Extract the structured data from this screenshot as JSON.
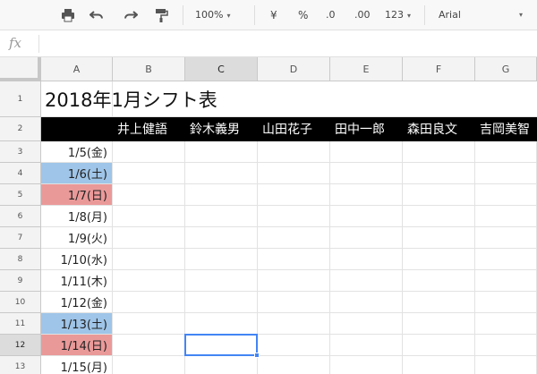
{
  "toolbar": {
    "zoom": "100%",
    "currency_symbol": "¥",
    "percent_symbol": "%",
    "decrease_decimal": ".0",
    "increase_decimal": ".00",
    "more_formats": "123",
    "font_name": "Arial",
    "caret": "▾"
  },
  "formula_bar": {
    "fx_label": "fx",
    "value": ""
  },
  "columns": [
    "A",
    "B",
    "C",
    "D",
    "E",
    "F",
    "G"
  ],
  "active_column": "C",
  "rows": [
    "1",
    "2",
    "3",
    "4",
    "5",
    "6",
    "7",
    "8",
    "9",
    "10",
    "11",
    "12",
    "13"
  ],
  "active_row": "12",
  "sheet": {
    "title": "2018年1月シフト表",
    "names": [
      "井上健語",
      "鈴木義男",
      "山田花子",
      "田中一郎",
      "森田良文",
      "吉岡美智"
    ],
    "dates": [
      {
        "label": "1/5(金)",
        "day_type": "weekday"
      },
      {
        "label": "1/6(土)",
        "day_type": "saturday"
      },
      {
        "label": "1/7(日)",
        "day_type": "sunday"
      },
      {
        "label": "1/8(月)",
        "day_type": "weekday"
      },
      {
        "label": "1/9(火)",
        "day_type": "weekday"
      },
      {
        "label": "1/10(水)",
        "day_type": "weekday"
      },
      {
        "label": "1/11(木)",
        "day_type": "weekday"
      },
      {
        "label": "1/12(金)",
        "day_type": "weekday"
      },
      {
        "label": "1/13(土)",
        "day_type": "saturday"
      },
      {
        "label": "1/14(日)",
        "day_type": "sunday"
      },
      {
        "label": "1/15(月)",
        "day_type": "weekday"
      }
    ]
  },
  "selected_cell": "C12",
  "colors": {
    "saturday_fill": "#9fc5e8",
    "sunday_fill": "#ea9999",
    "header_fill": "#000000",
    "selection": "#4285f4"
  }
}
